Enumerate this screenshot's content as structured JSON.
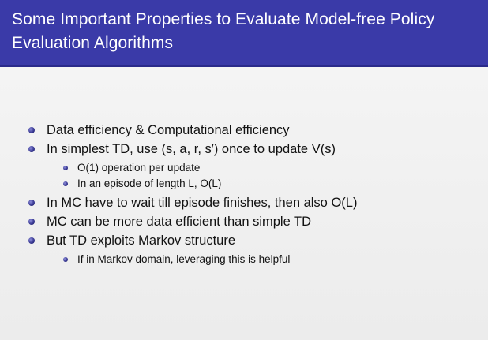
{
  "slide": {
    "title": "Some Important Properties to Evaluate Model-free Policy Evaluation Algorithms",
    "bullets": [
      {
        "text": "Data efficiency & Computational efficiency"
      },
      {
        "text": "In simplest TD, use (s, a, r, s′) once to update V(s)",
        "subs": [
          "O(1) operation per update",
          "In an episode of length L, O(L)"
        ]
      },
      {
        "text": "In MC have to wait till episode finishes, then also O(L)"
      },
      {
        "text": "MC can be more data efficient than simple TD"
      },
      {
        "text": "But TD exploits Markov structure",
        "subs": [
          "If in Markov domain, leveraging this is helpful"
        ]
      }
    ]
  },
  "colors": {
    "title_bar": "#3a3aa8",
    "title_text": "#ffffff",
    "bullet": "#35358f"
  }
}
